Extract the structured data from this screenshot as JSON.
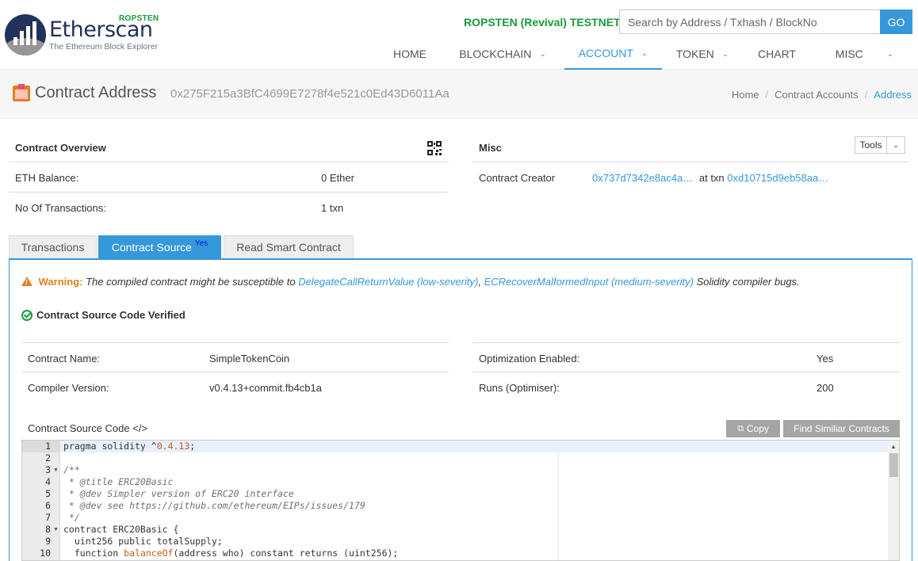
{
  "header": {
    "logo": {
      "network_tag": "ROPSTEN",
      "name": "Etherscan",
      "tagline": "The Ethereum Block Explorer"
    },
    "network_label": "ROPSTEN (Revival) TESTNET",
    "search": {
      "placeholder": "Search by Address / Txhash / BlockNo",
      "go_label": "GO"
    },
    "nav": [
      {
        "label": "HOME",
        "caret": false,
        "active": false
      },
      {
        "label": "BLOCKCHAIN",
        "caret": true,
        "active": false
      },
      {
        "label": "ACCOUNT",
        "caret": true,
        "active": true
      },
      {
        "label": "TOKEN",
        "caret": true,
        "active": false
      },
      {
        "label": "CHART",
        "caret": false,
        "active": false
      },
      {
        "label": "MISC",
        "caret": true,
        "active": false
      }
    ]
  },
  "title_bar": {
    "title": "Contract Address",
    "address": "0x275F215a3BfC4699E7278f4e521c0Ed43D6011Aa",
    "breadcrumb": [
      "Home",
      "Contract Accounts",
      "Address"
    ]
  },
  "overview": {
    "title": "Contract Overview",
    "balance_label": "ETH Balance:",
    "balance_value": "0 Ether",
    "tx_label": "No Of Transactions:",
    "tx_value": "1 txn"
  },
  "misc": {
    "title": "Misc",
    "tools_label": "Tools",
    "creator_label": "Contract Creator",
    "creator_address": "0x737d7342e8ac4a…",
    "at_txn_label": "at txn",
    "creator_txn": "0xd10715d9eb58aa…"
  },
  "tabs": [
    {
      "label": "Transactions",
      "active": false,
      "badge": ""
    },
    {
      "label": "Contract Source",
      "active": true,
      "badge": "Yes"
    },
    {
      "label": "Read Smart Contract",
      "active": false,
      "badge": ""
    }
  ],
  "warning": {
    "label": "Warning:",
    "text_before": "The compiled contract might be susceptible to",
    "link1": "DelegateCallReturnValue (low-severity)",
    "separator": ",",
    "link2": "ECRecoverMalformedInput (medium-severity)",
    "text_after": "Solidity compiler bugs."
  },
  "verified_label": "Contract Source Code Verified",
  "details": {
    "name_label": "Contract Name:",
    "name_value": "SimpleTokenCoin",
    "compiler_label": "Compiler Version:",
    "compiler_value": "v0.4.13+commit.fb4cb1a",
    "optimization_label": "Optimization Enabled:",
    "optimization_value": "Yes",
    "runs_label": "Runs (Optimiser):",
    "runs_value": "200"
  },
  "source": {
    "title": "Contract Source Code </>",
    "copy_label": "Copy",
    "similar_label": "Find Similiar Contracts",
    "lines": [
      {
        "n": "1",
        "fold": false
      },
      {
        "n": "2",
        "fold": false
      },
      {
        "n": "3",
        "fold": true
      },
      {
        "n": "4",
        "fold": false
      },
      {
        "n": "5",
        "fold": false
      },
      {
        "n": "6",
        "fold": false
      },
      {
        "n": "7",
        "fold": false
      },
      {
        "n": "8",
        "fold": true
      },
      {
        "n": "9",
        "fold": false
      },
      {
        "n": "10",
        "fold": false
      }
    ],
    "code": {
      "l1_a": "pragma solidity ^",
      "l1_b": "0.4.13",
      "l1_c": ";",
      "l3": "/**",
      "l4": " * @title ERC20Basic",
      "l5": " * @dev Simpler version of ERC20 interface",
      "l6": " * @dev see https://github.com/ethereum/EIPs/issues/179",
      "l7": " */",
      "l8": "contract ERC20Basic {",
      "l9": "  uint256 public totalSupply;",
      "l10_a": "  function ",
      "l10_b": "balanceOf",
      "l10_c": "(address who) constant returns (uint256);"
    }
  }
}
